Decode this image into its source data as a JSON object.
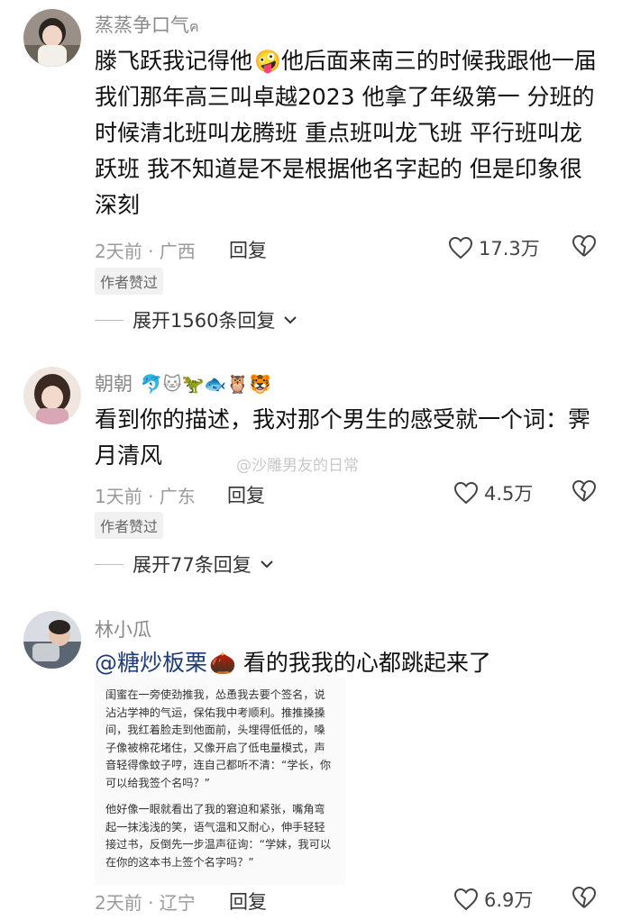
{
  "watermark": "@沙雕男友的日常",
  "comments": [
    {
      "username": "蒸蒸争口气",
      "username_suffix": "ฅ",
      "text_before_emoji": "滕飞跃我记得他",
      "inline_emoji": "🤪",
      "text_after_emoji": "他后面来南三的时候我跟他一届 我们那年高三叫卓越2023 他拿了年级第一 分班的时候清北班叫龙腾班 重点班叫龙飞班 平行班叫龙跃班 我不知道是不是根据他名字起的 但是印象很深刻",
      "time_location": "2天前 · 广西",
      "reply_label": "回复",
      "likes": "17.3万",
      "author_badge": "作者赞过",
      "expand_label": "展开1560条回复"
    },
    {
      "username": "朝朝",
      "username_emojis": "🐬🐱🦖🐟🦉🐯",
      "text": "看到你的描述，我对那个男生的感受就一个词：霁月清风",
      "time_location": "1天前 · 广东",
      "reply_label": "回复",
      "likes": "4.5万",
      "author_badge": "作者赞过",
      "expand_label": "展开77条回复"
    },
    {
      "username": "林小瓜",
      "mention": "@糖炒板栗",
      "inline_emoji": "🌰",
      "text": "看的我我的心都跳起来了",
      "inset_paragraph1": "闺蜜在一旁使劲推我，怂恿我去要个签名，说沾沾学神的气运，保佑我中考顺利。推推搡搡间，我红着脸走到他面前，头埋得低低的，嗓子像被棉花堵住，又像开启了低电量模式，声音轻得像蚊子哼，连自己都听不清：“学长，你可以给我签个名吗？”",
      "inset_paragraph2": "他好像一眼就看出了我的窘迫和紧张，嘴角弯起一抹浅浅的笑，语气温和又耐心，伸手轻轻接过书，反倒先一步温声征询：“学妹，我可以在你的这本书上签个名字吗？”",
      "time_location": "2天前 · 辽宁",
      "reply_label": "回复",
      "likes": "6.9万"
    }
  ]
}
